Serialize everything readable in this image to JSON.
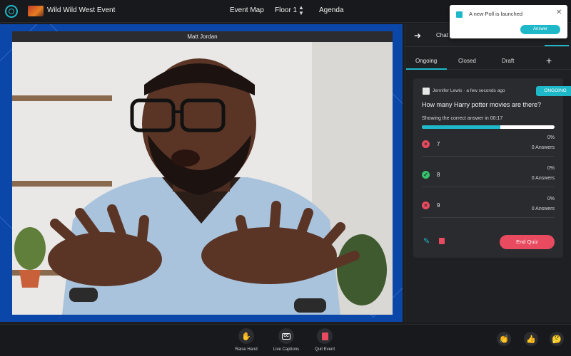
{
  "topbar": {
    "event_name": "Wild Wild West Event",
    "nav": {
      "event_map": "Event Map",
      "floor": "Floor 1",
      "agenda": "Agenda"
    }
  },
  "stage": {
    "speaker_name": "Matt Jordan"
  },
  "panel": {
    "header_tab": "Chat",
    "subtabs": [
      "Ongoing",
      "Closed",
      "Draft"
    ],
    "add_label": "+"
  },
  "poll": {
    "author": "Jennifer Lewis",
    "time_sep": " · ",
    "time": "a few seconds ago",
    "status": "ONGOING",
    "question": "How many Harry potter movies are there?",
    "showing_text": "Showing the correct answer in 00:17",
    "progress": 0.59,
    "options": [
      {
        "label": "7",
        "result": "wrong",
        "mark": "×",
        "percent": "0%",
        "answers": "0 Answers"
      },
      {
        "label": "8",
        "result": "correct",
        "mark": "✓",
        "percent": "0%",
        "answers": "0 Answers"
      },
      {
        "label": "9",
        "result": "wrong",
        "mark": "×",
        "percent": "0%",
        "answers": "0 Answers"
      }
    ],
    "end_label": "End Quiz"
  },
  "notification": {
    "text": "A new Poll is launched",
    "action": "Answer",
    "close": "✕"
  },
  "controls": {
    "raise_hand": "Raise Hand",
    "live_captions": "Live Captions",
    "quit_event": "Quit Event"
  },
  "reactions": [
    "clap-icon",
    "thumbs-up-icon",
    "thinking-icon"
  ],
  "colors": {
    "accent": "#1fb8c9",
    "danger": "#e84a5f",
    "success": "#34c36b",
    "stage_bg": "#0b47a8"
  }
}
